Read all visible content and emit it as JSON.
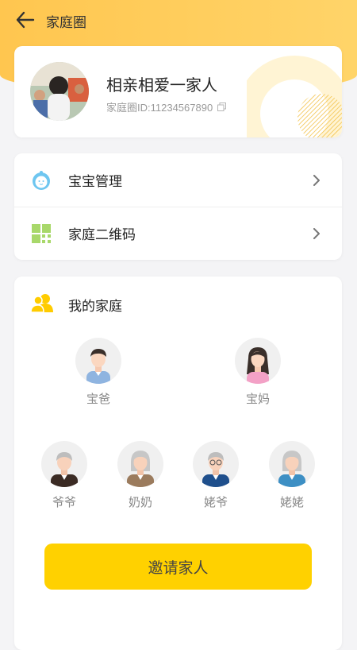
{
  "header": {
    "title": "家庭圈"
  },
  "profile": {
    "name": "相亲相爱一家人",
    "id_text": "家庭圈ID:11234567890"
  },
  "menu": [
    {
      "label": "宝宝管理",
      "icon": "baby-icon"
    },
    {
      "label": "家庭二维码",
      "icon": "qrcode-icon"
    }
  ],
  "family": {
    "title": "我的家庭",
    "parents": [
      {
        "name": "宝爸",
        "icon": "dad-avatar"
      },
      {
        "name": "宝妈",
        "icon": "mom-avatar"
      }
    ],
    "grandparents": [
      {
        "name": "爷爷",
        "icon": "grandpa-avatar"
      },
      {
        "name": "奶奶",
        "icon": "grandma-avatar"
      },
      {
        "name": "姥爷",
        "icon": "maternal-grandpa-avatar"
      },
      {
        "name": "姥姥",
        "icon": "maternal-grandma-avatar"
      }
    ],
    "invite_label": "邀请家人"
  },
  "colors": {
    "header_bg": "#ffc64f",
    "accent": "#ffd100",
    "baby_icon": "#6ec6f0",
    "qrcode_icon": "#a8d86a",
    "family_icon": "#ffcc00"
  }
}
